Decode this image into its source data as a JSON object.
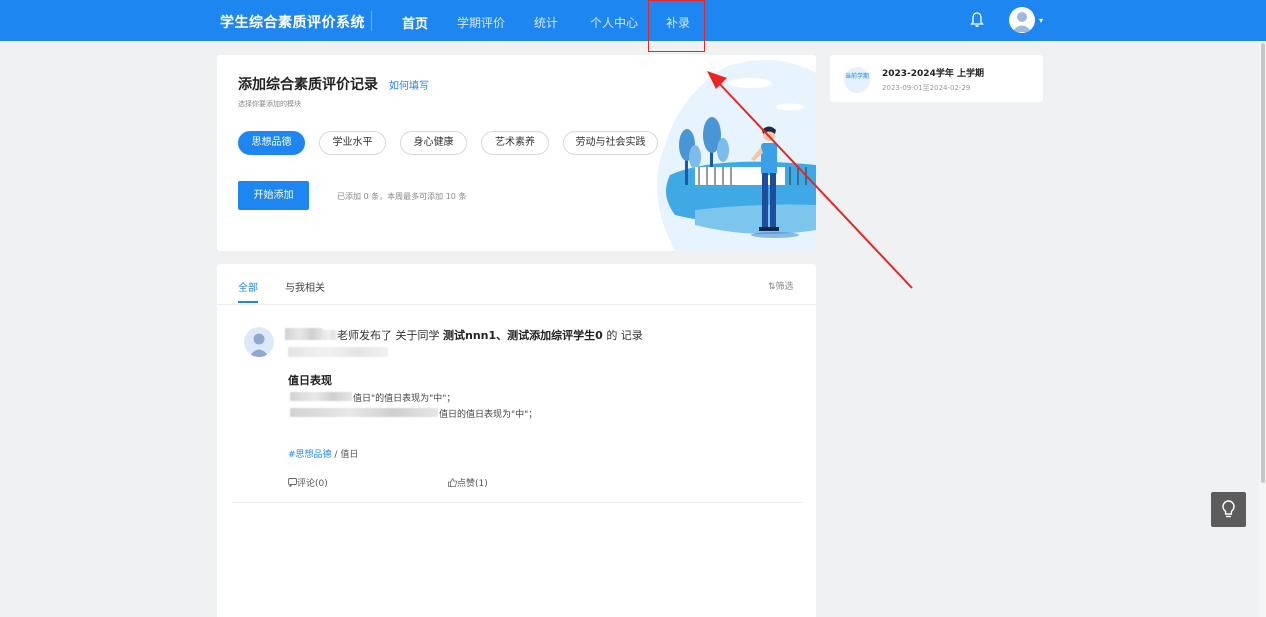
{
  "app": {
    "title": "学生综合素质评价系统"
  },
  "nav": {
    "items": [
      {
        "label": "首页",
        "active": true
      },
      {
        "label": "学期评价"
      },
      {
        "label": "统计"
      },
      {
        "label": "个人中心"
      },
      {
        "label": "补录",
        "highlighted": true
      }
    ],
    "icons": {
      "bell": "bell-icon",
      "avatar": "user-avatar-icon",
      "caret": "caret-down-icon"
    },
    "caret_glyph": "▾"
  },
  "add_card": {
    "title": "添加综合素质评价记录",
    "help_link": "如何填写",
    "subtitle": "选择你要添加的模块",
    "modules": [
      "思想品德",
      "学业水平",
      "身心健康",
      "艺术素养",
      "劳动与社会实践"
    ],
    "selected_module": "思想品德",
    "start_button": "开始添加",
    "count_text": "已添加 0 条，本周最多可添加 10 条"
  },
  "feed": {
    "tabs": [
      "全部",
      "与我相关"
    ],
    "active_tab": "全部",
    "filter_label": "⇅筛选",
    "post": {
      "headline_suffix": "老师发布了 关于同学",
      "students": "测试nnn1、测试添加综评学生0",
      "headline_end": "的 记录",
      "record_title": "值日表现",
      "line1": "值日\"的值日表现为\"中\"；",
      "line2": "值日的值日表现为\"中\"；",
      "tag": "#思想品德",
      "tag_sub": "/ 值日",
      "comment": "评论(0)",
      "like": "点赞(1)"
    }
  },
  "term": {
    "badge": "当前学期",
    "title": "2023-2024学年 上学期",
    "range": "2023-09-01至2024-02-29"
  },
  "colors": {
    "primary": "#1e86f1",
    "annotation_red": "#e82424"
  }
}
